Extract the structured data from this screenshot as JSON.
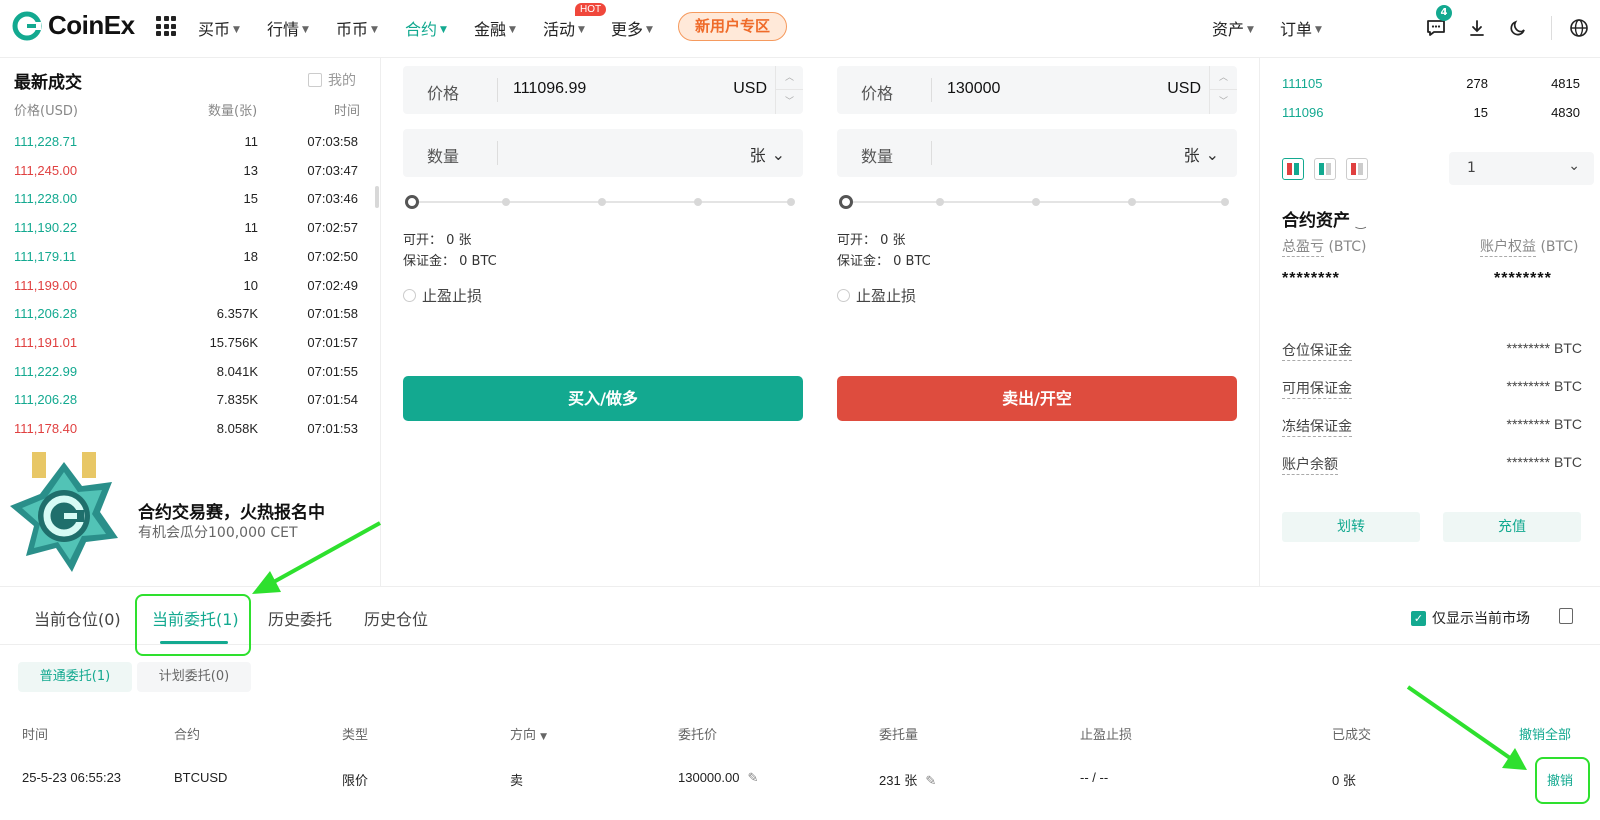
{
  "header": {
    "logo_text": "CoinEx",
    "nav": [
      "买币",
      "行情",
      "币币",
      "合约",
      "金融",
      "活动",
      "更多"
    ],
    "hot_label": "HOT",
    "new_user": "新用户专区",
    "assets": "资产",
    "orders": "订单",
    "message_count": "4",
    "accent_color": "#13a990"
  },
  "trades": {
    "title": "最新成交",
    "mine_label": "我的",
    "col_price": "价格(USD)",
    "col_qty": "数量(张)",
    "col_time": "时间",
    "rows": [
      {
        "price": "111,228.71",
        "qty": "11",
        "time": "07:03:58",
        "side": "up"
      },
      {
        "price": "111,245.00",
        "qty": "13",
        "time": "07:03:47",
        "side": "down"
      },
      {
        "price": "111,228.00",
        "qty": "15",
        "time": "07:03:46",
        "side": "up"
      },
      {
        "price": "111,190.22",
        "qty": "11",
        "time": "07:02:57",
        "side": "up"
      },
      {
        "price": "111,179.11",
        "qty": "18",
        "time": "07:02:50",
        "side": "up"
      },
      {
        "price": "111,199.00",
        "qty": "10",
        "time": "07:02:49",
        "side": "down"
      },
      {
        "price": "111,206.28",
        "qty": "6.357K",
        "time": "07:01:58",
        "side": "up"
      },
      {
        "price": "111,191.01",
        "qty": "15.756K",
        "time": "07:01:57",
        "side": "down"
      },
      {
        "price": "111,222.99",
        "qty": "8.041K",
        "time": "07:01:55",
        "side": "up"
      },
      {
        "price": "111,206.28",
        "qty": "7.835K",
        "time": "07:01:54",
        "side": "up"
      },
      {
        "price": "111,178.40",
        "qty": "8.058K",
        "time": "07:01:53",
        "side": "down"
      }
    ]
  },
  "promo": {
    "title": "合约交易赛，火热报名中",
    "subtitle": "有机会瓜分100,000 CET"
  },
  "buy_form": {
    "price_label": "价格",
    "price_value": "111096.99",
    "price_unit": "USD",
    "qty_label": "数量",
    "qty_unit": "张",
    "open_label": "可开：",
    "open_value": "0 张",
    "margin_label": "保证金：",
    "margin_value": "0 BTC",
    "tpsl_label": "止盈止损",
    "submit": "买入/做多"
  },
  "sell_form": {
    "price_label": "价格",
    "price_value": "130000",
    "price_unit": "USD",
    "qty_label": "数量",
    "qty_unit": "张",
    "open_label": "可开：",
    "open_value": "0 张",
    "margin_label": "保证金：",
    "margin_value": "0 BTC",
    "tpsl_label": "止盈止损",
    "submit": "卖出/开空"
  },
  "orderbook": {
    "rows": [
      {
        "price": "111105",
        "qty": "278",
        "total": "4815"
      },
      {
        "price": "111096",
        "qty": "15",
        "total": "4830"
      }
    ],
    "depth": "1"
  },
  "assets": {
    "title": "合约资产",
    "total_pnl_label": "总盈亏",
    "equity_label": "账户权益",
    "unit_paren": "(BTC)",
    "masked": "********",
    "rows": [
      {
        "label": "仓位保证金",
        "value": "********",
        "unit": "BTC"
      },
      {
        "label": "可用保证金",
        "value": "********",
        "unit": "BTC"
      },
      {
        "label": "冻结保证金",
        "value": "********",
        "unit": "BTC"
      },
      {
        "label": "账户余额",
        "value": "********",
        "unit": "BTC"
      }
    ],
    "transfer": "划转",
    "deposit": "充值"
  },
  "bottom": {
    "tabs": [
      "当前仓位(0)",
      "当前委托(1)",
      "历史委托",
      "历史仓位"
    ],
    "only_current": "仅显示当前市场",
    "subtabs": [
      "普通委托(1)",
      "计划委托(0)"
    ],
    "columns": [
      "时间",
      "合约",
      "类型",
      "方向",
      "委托价",
      "委托量",
      "止盈止损",
      "已成交"
    ],
    "cancel_all": "撤销全部",
    "order": {
      "time": "25-5-23 06:55:23",
      "contract": "BTCUSD",
      "type": "限价",
      "side": "卖",
      "price": "130000.00",
      "qty": "231 张",
      "tpsl": "-- / --",
      "filled": "0 张",
      "cancel": "撤销"
    }
  }
}
